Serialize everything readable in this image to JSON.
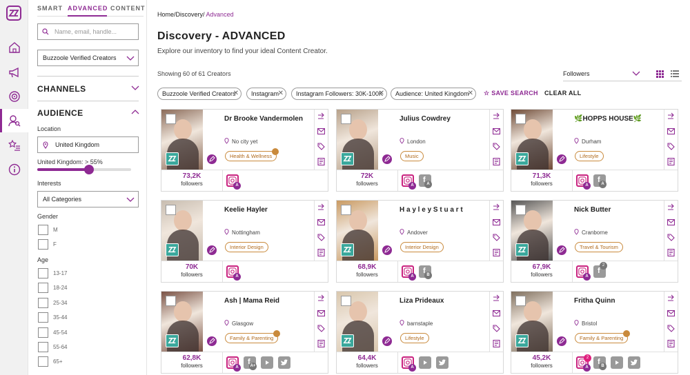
{
  "colors": {
    "accent": "#8e2a93",
    "brand_green": "#3aa89c",
    "category": "#c98a3c",
    "instagram": "#c9227f"
  },
  "tabs": [
    "SMART",
    "ADVANCED",
    "CONTENT"
  ],
  "sidebar": {
    "search_placeholder": "Name, email, handle...",
    "creator_type": "Buzzoole Verified Creators",
    "channels_label": "CHANNELS",
    "audience_label": "AUDIENCE",
    "location_label": "Location",
    "location_value": "United Kingdom",
    "slider_label": "United Kingdom: > 55%",
    "slider_level_pct": 55,
    "interests_label": "Interests",
    "interests_value": "All Categories",
    "gender_label": "Gender",
    "genders": [
      "M",
      "F"
    ],
    "age_label": "Age",
    "ages": [
      "13-17",
      "18-24",
      "25-34",
      "35-44",
      "45-54",
      "55-64",
      "65+"
    ]
  },
  "breadcrumb": {
    "home": "Home/",
    "discovery": "Discovery/",
    "current": "Advanced"
  },
  "page_title": "Discovery - ADVANCED",
  "page_subtitle": "Explore our inventory to find your ideal Content Creator.",
  "showing": "Showing 60 of 61 Creators",
  "sort_value": "Followers",
  "chips": [
    "Buzzoole Verified Creators",
    "Instagram",
    "Instagram Followers: 30K-100K",
    "Audience: United Kingdom"
  ],
  "save_search": "SAVE SEARCH",
  "clear_all": "CLEAR ALL",
  "followers_label": "followers",
  "cards": [
    {
      "name": "Dr Brooke Vandermolen",
      "location": "No city yet",
      "category": "Health & Wellness",
      "followers": "73,2K",
      "photo": "#8a6a58",
      "cat_more": true,
      "socials": [
        {
          "t": "ig",
          "b": "A"
        }
      ]
    },
    {
      "name": "Julius Cowdrey",
      "location": "London",
      "category": "Music",
      "followers": "72K",
      "photo": "#b7a18a",
      "cat_more": false,
      "socials": [
        {
          "t": "ig",
          "b": "A"
        },
        {
          "t": "fb",
          "b": "A"
        }
      ]
    },
    {
      "name": "🌿HOPPS HOUSE🌿",
      "location": "Durham",
      "category": "Lifestyle",
      "followers": "71,3K",
      "photo": "#6e4a36",
      "cat_more": false,
      "socials": [
        {
          "t": "ig",
          "b": "A"
        },
        {
          "t": "fb",
          "b": "A"
        }
      ]
    },
    {
      "name": "Keelie Hayler",
      "location": "Nottingham",
      "category": "Interior Design",
      "followers": "70K",
      "photo": "#c8bdb0",
      "cat_more": false,
      "socials": [
        {
          "t": "ig",
          "b": "A"
        }
      ]
    },
    {
      "name": "H a y l e y S t u a r t",
      "location": "Andover",
      "category": "Interior Design",
      "followers": "68,9K",
      "photo": "#c99a62",
      "cat_more": false,
      "socials": [
        {
          "t": "ig",
          "b": "A"
        },
        {
          "t": "fb",
          "b": "B"
        }
      ]
    },
    {
      "name": "Nick Butter",
      "location": "Cranborne",
      "category": "Travel & Tourism",
      "followers": "67,9K",
      "photo": "#555555",
      "cat_more": false,
      "socials": [
        {
          "t": "ig",
          "b": "A"
        },
        {
          "t": "fb",
          "n": "2"
        }
      ]
    },
    {
      "name": "Ash | Mama Reid",
      "location": "Glasgow",
      "category": "Family & Parenting",
      "followers": "62,8K",
      "photo": "#7a5245",
      "cat_more": true,
      "socials": [
        {
          "t": "ig",
          "b": "A"
        },
        {
          "t": "fb",
          "b": "A+"
        },
        {
          "t": "yt"
        },
        {
          "t": "tw"
        }
      ]
    },
    {
      "name": "Liza Prideaux",
      "location": "barnstaple",
      "category": "Lifestyle",
      "followers": "64,4K",
      "photo": "#d9c7ad",
      "cat_more": false,
      "socials": [
        {
          "t": "ig",
          "b": "A"
        },
        {
          "t": "yt"
        },
        {
          "t": "tw"
        }
      ]
    },
    {
      "name": "Fritha Quinn",
      "location": "Bristol",
      "category": "Family & Parenting",
      "followers": "45,2K",
      "photo": "#7f6f5e",
      "cat_more": true,
      "socials": [
        {
          "t": "ig",
          "b": "A",
          "n": "2"
        },
        {
          "t": "fb",
          "b": "B"
        },
        {
          "t": "yt"
        },
        {
          "t": "tw"
        }
      ]
    }
  ]
}
